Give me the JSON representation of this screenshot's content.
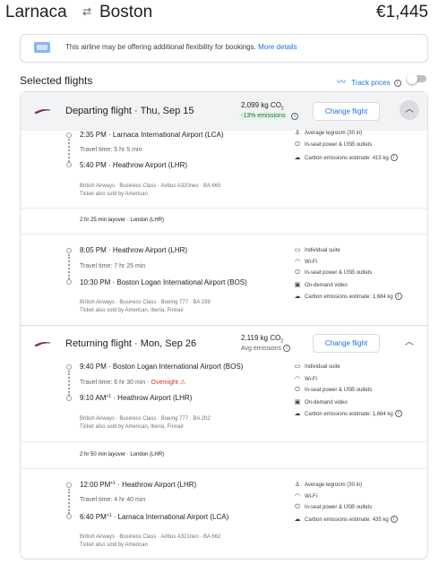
{
  "header": {
    "origin": "Larnaca",
    "swap_icon": "swap-arrows-icon",
    "destination": "Boston",
    "price": "€1,445"
  },
  "notice": {
    "text": "This airline may be offering additional flexibility for bookings.",
    "link": "More details"
  },
  "selected": {
    "title": "Selected flights",
    "track_label": "Track prices"
  },
  "departing": {
    "title": "Departing flight",
    "date": "Thu, Sep 15",
    "co2": "2,099 kg CO",
    "co2_sub": "2",
    "co2_badge": "-13% emissions",
    "change_label": "Change flight",
    "segments": [
      {
        "dep_time": "2:35 PM",
        "dep_airport": "Larnaca International Airport (LCA)",
        "travel": "Travel time: 5 hr 5 min",
        "arr_time": "5:40 PM",
        "arr_airport": "Heathrow Airport (LHR)",
        "meta1": "British Airways · Business Class · Airbus A320neo · BA 665",
        "meta2": "Ticket also sold by American",
        "amenities": [
          "Average legroom (30 in)",
          "In-seat power & USB outlets",
          "Carbon emissions estimate: 415 kg"
        ]
      },
      {
        "dep_time": "8:05 PM",
        "dep_airport": "Heathrow Airport (LHR)",
        "travel": "Travel time: 7 hr 25 min",
        "arr_time": "10:30 PM",
        "arr_airport": "Boston Logan International Airport (BOS)",
        "meta1": "British Airways · Business Class · Boeing 777 · BA 239",
        "meta2": "Ticket also sold by American, Iberia, Finnair",
        "amenities": [
          "Individual suite",
          "Wi-Fi",
          "In-seat power & USB outlets",
          "On-demand video",
          "Carbon emissions estimate: 1,684 kg"
        ]
      }
    ],
    "layover": "2 hr 25 min layover · London (LHR)"
  },
  "returning": {
    "title": "Returning flight",
    "date": "Mon, Sep 26",
    "co2": "2,119 kg CO",
    "co2_sub": "2",
    "co2_note": "Avg emissions",
    "change_label": "Change flight",
    "segments": [
      {
        "dep_time": "9:40 PM",
        "dep_airport": "Boston Logan International Airport (BOS)",
        "travel": "Travel time: 6 hr 30 min",
        "overnight": "Overnight",
        "arr_time": "9:10 AM",
        "arr_plus": "+1",
        "arr_airport": "Heathrow Airport (LHR)",
        "meta1": "British Airways · Business Class · Boeing 777 · BA 202",
        "meta2": "Ticket also sold by American, Iberia, Finnair",
        "amenities": [
          "Individual suite",
          "Wi-Fi",
          "In-seat power & USB outlets",
          "On-demand video",
          "Carbon emissions estimate: 1,684 kg"
        ]
      },
      {
        "dep_time": "12:00 PM",
        "dep_plus": "+1",
        "dep_airport": "Heathrow Airport (LHR)",
        "travel": "Travel time: 4 hr 40 min",
        "arr_time": "6:40 PM",
        "arr_plus": "+1",
        "arr_airport": "Larnaca International Airport (LCA)",
        "meta1": "British Airways · Business Class · Airbus A321neo · BA 662",
        "meta2": "Ticket also sold by American",
        "amenities": [
          "Average legroom (30 in)",
          "Wi-Fi",
          "In-seat power & USB outlets",
          "Carbon emissions estimate: 435 kg"
        ]
      }
    ],
    "layover": "2 hr 50 min layover · London (LHR)"
  },
  "colors": {
    "accent": "#1a73e8",
    "green": "#137333",
    "red": "#d93025"
  }
}
